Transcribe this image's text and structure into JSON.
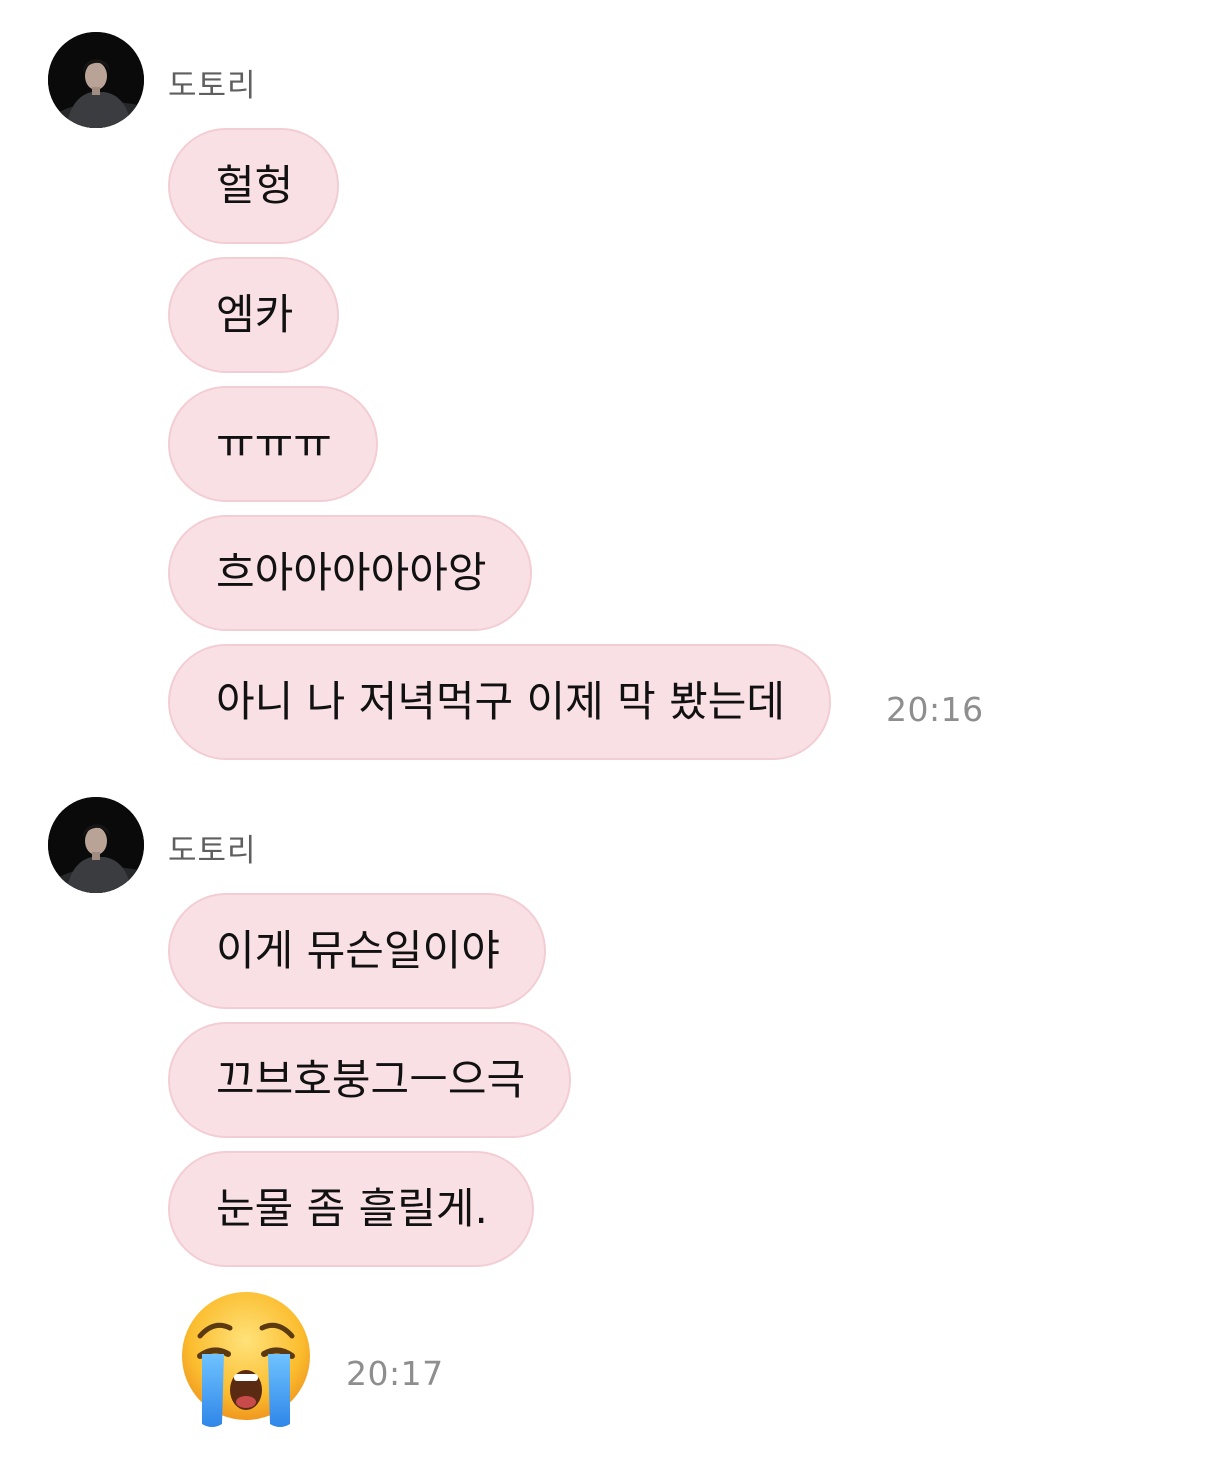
{
  "sender_name": "도토리",
  "groups": [
    {
      "messages": [
        "헐헝",
        "엠카",
        "ㅠㅠㅠ",
        "흐아아아아아앙",
        "아니 나 저녁먹구 이제 막 봤는데"
      ],
      "time": "20:16"
    },
    {
      "messages": [
        "이게 뮤슨일이야",
        "끄브호붕그ㅡ으극",
        "눈물 좀 흘릴게."
      ],
      "emoji": "loudly-crying-face",
      "time": "20:17"
    }
  ],
  "colors": {
    "bubble_fill": "#f9e0e4",
    "bubble_border": "#f3cdd4",
    "sender_text": "#5f5f5f",
    "time_text": "#8e8e8e"
  }
}
